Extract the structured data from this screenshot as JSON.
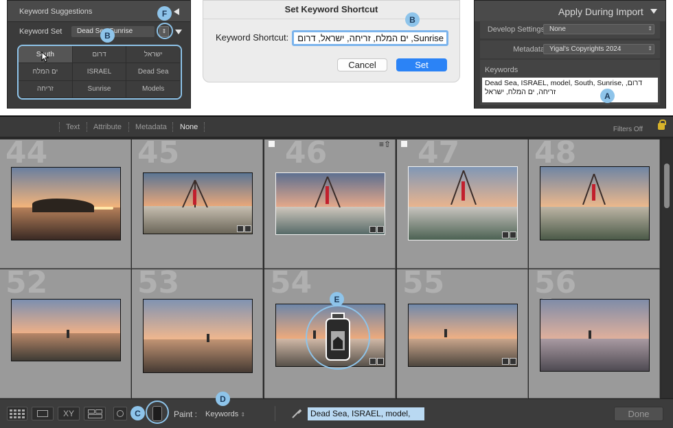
{
  "keyword_panel": {
    "header": "Keyword Suggestions",
    "set_label": "Keyword Set",
    "set_value": "Dead Sea Sunrise",
    "grid": [
      "South",
      "דרום",
      "ישראל",
      "ים המלח",
      "ISRAEL",
      "Dead Sea",
      "זריחה",
      "Sunrise",
      "Models"
    ]
  },
  "dialog": {
    "title": "Set Keyword Shortcut",
    "field_label": "Keyword Shortcut:",
    "field_value": "Sunrise, ים המלח, זריחה, ישראל, דרום",
    "cancel": "Cancel",
    "set": "Set"
  },
  "import_panel": {
    "title": "Apply During Import",
    "develop_label": "Develop Settings",
    "develop_value": "None",
    "metadata_label": "Metadata",
    "metadata_value": "Yigal's Copyrights 2024",
    "keywords_label": "Keywords",
    "keywords_value": "Dead Sea, ISRAEL, model, South, Sunrise, דרום, זריחה, ים המלח, ישראל"
  },
  "filter_bar": {
    "items": [
      "Text",
      "Attribute",
      "Metadata",
      "None"
    ],
    "filters_off": "Filters Off"
  },
  "grid": {
    "row1": [
      "44",
      "45",
      "46",
      "47",
      "48"
    ],
    "row2": [
      "52",
      "53",
      "54",
      "55",
      "56"
    ]
  },
  "toolbar": {
    "paint_label": "Paint :",
    "paint_value": "Keywords",
    "keyword_input": "Dead Sea, ISRAEL, model,",
    "done": "Done"
  },
  "callouts": {
    "a": "A",
    "b": "B",
    "b2": "B",
    "c": "C",
    "d": "D",
    "e": "E",
    "f": "F"
  },
  "colors": {
    "accent": "#8ec4ea",
    "set_button": "#2b83f6",
    "panel_bg": "#3b3b3b",
    "grid_bg": "#9a9a9a"
  }
}
